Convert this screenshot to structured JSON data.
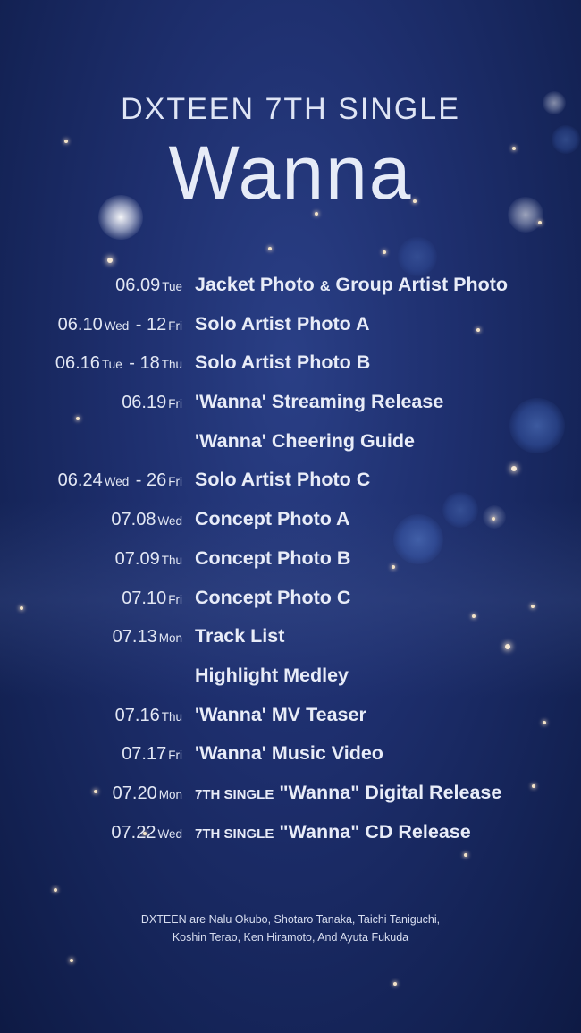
{
  "header": {
    "subtitle": "DXTEEN 7TH SINGLE",
    "title": "Wanna"
  },
  "schedule": [
    {
      "date": "06.09",
      "day": "Tue",
      "date_end": "",
      "day_end": "",
      "event": "Jacket Photo",
      "joiner": "&",
      "event2": "Group Artist Photo"
    },
    {
      "date": "06.10",
      "day": "Wed",
      "date_end": "12",
      "day_end": "Fri",
      "event": "Solo Artist Photo A"
    },
    {
      "date": "06.16",
      "day": "Tue",
      "date_end": "18",
      "day_end": "Thu",
      "event": "Solo Artist Photo B"
    },
    {
      "date": "06.19",
      "day": "Fri",
      "date_end": "",
      "day_end": "",
      "event": "'Wanna' Streaming Release"
    },
    {
      "date": "",
      "day": "",
      "date_end": "",
      "day_end": "",
      "event": "'Wanna' Cheering Guide"
    },
    {
      "date": "06.24",
      "day": "Wed",
      "date_end": "26",
      "day_end": "Fri",
      "event": "Solo Artist Photo C"
    },
    {
      "date": "07.08",
      "day": "Wed",
      "date_end": "",
      "day_end": "",
      "event": "Concept Photo A"
    },
    {
      "date": "07.09",
      "day": "Thu",
      "date_end": "",
      "day_end": "",
      "event": "Concept Photo B"
    },
    {
      "date": "07.10",
      "day": "Fri",
      "date_end": "",
      "day_end": "",
      "event": "Concept Photo C"
    },
    {
      "date": "07.13",
      "day": "Mon",
      "date_end": "",
      "day_end": "",
      "event": "Track List"
    },
    {
      "date": "",
      "day": "",
      "date_end": "",
      "day_end": "",
      "event": "Highlight Medley"
    },
    {
      "date": "07.16",
      "day": "Thu",
      "date_end": "",
      "day_end": "",
      "event": "'Wanna' MV Teaser"
    },
    {
      "date": "07.17",
      "day": "Fri",
      "date_end": "",
      "day_end": "",
      "event": "'Wanna' Music Video"
    },
    {
      "date": "07.20",
      "day": "Mon",
      "date_end": "",
      "day_end": "",
      "prefix": "7TH SINGLE",
      "event": "\"Wanna\" Digital Release"
    },
    {
      "date": "07.22",
      "day": "Wed",
      "date_end": "",
      "day_end": "",
      "prefix": "7TH SINGLE",
      "event": "\"Wanna\" CD Release"
    }
  ],
  "footer": {
    "line1": "DXTEEN are Nalu Okubo, Shotaro Tanaka, Taichi Taniguchi,",
    "line2": "Koshin Terao, Ken Hiramoto, And Ayuta Fukuda"
  },
  "colors": {
    "background": "#1e2f6e",
    "text": "#e4e8f4"
  }
}
